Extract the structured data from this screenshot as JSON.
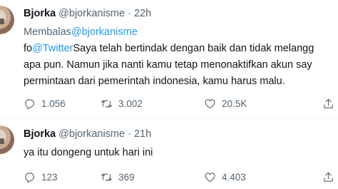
{
  "tweets": [
    {
      "name": "Bjorka",
      "handle": "@bjorkanisme",
      "separator": "·",
      "time": "22h",
      "reply_prefix": "Membalas",
      "reply_to": "@bjorkanisme",
      "text_lines": [
        {
          "prefix": "fo",
          "mention": "@Twitter",
          "rest": "Saya telah bertindak dengan baik dan tidak melangg"
        },
        {
          "prefix": "apa pun. Namun jika nanti kamu tetap menonaktifkan akun say",
          "mention": "",
          "rest": ""
        },
        {
          "prefix": "permintaan dari pemerintah indonesia, kamu harus malu.",
          "mention": "",
          "rest": ""
        }
      ],
      "stats": {
        "replies": "1.056",
        "retweets": "3.002",
        "likes": "20.5K"
      }
    },
    {
      "name": "Bjorka",
      "handle": "@bjorkanisme",
      "separator": "·",
      "time": "21h",
      "text_lines": [
        {
          "prefix": "ya itu dongeng untuk hari ini",
          "mention": "",
          "rest": ""
        }
      ],
      "stats": {
        "replies": "123",
        "retweets": "369",
        "likes": "4.403"
      }
    }
  ],
  "icons": {
    "reply": "reply-icon",
    "retweet": "retweet-icon",
    "like": "heart-icon",
    "share": "share-icon"
  },
  "colors": {
    "text": "#0f1419",
    "secondary": "#536471",
    "link": "#1d9bf0",
    "divider": "#eff3f4"
  }
}
